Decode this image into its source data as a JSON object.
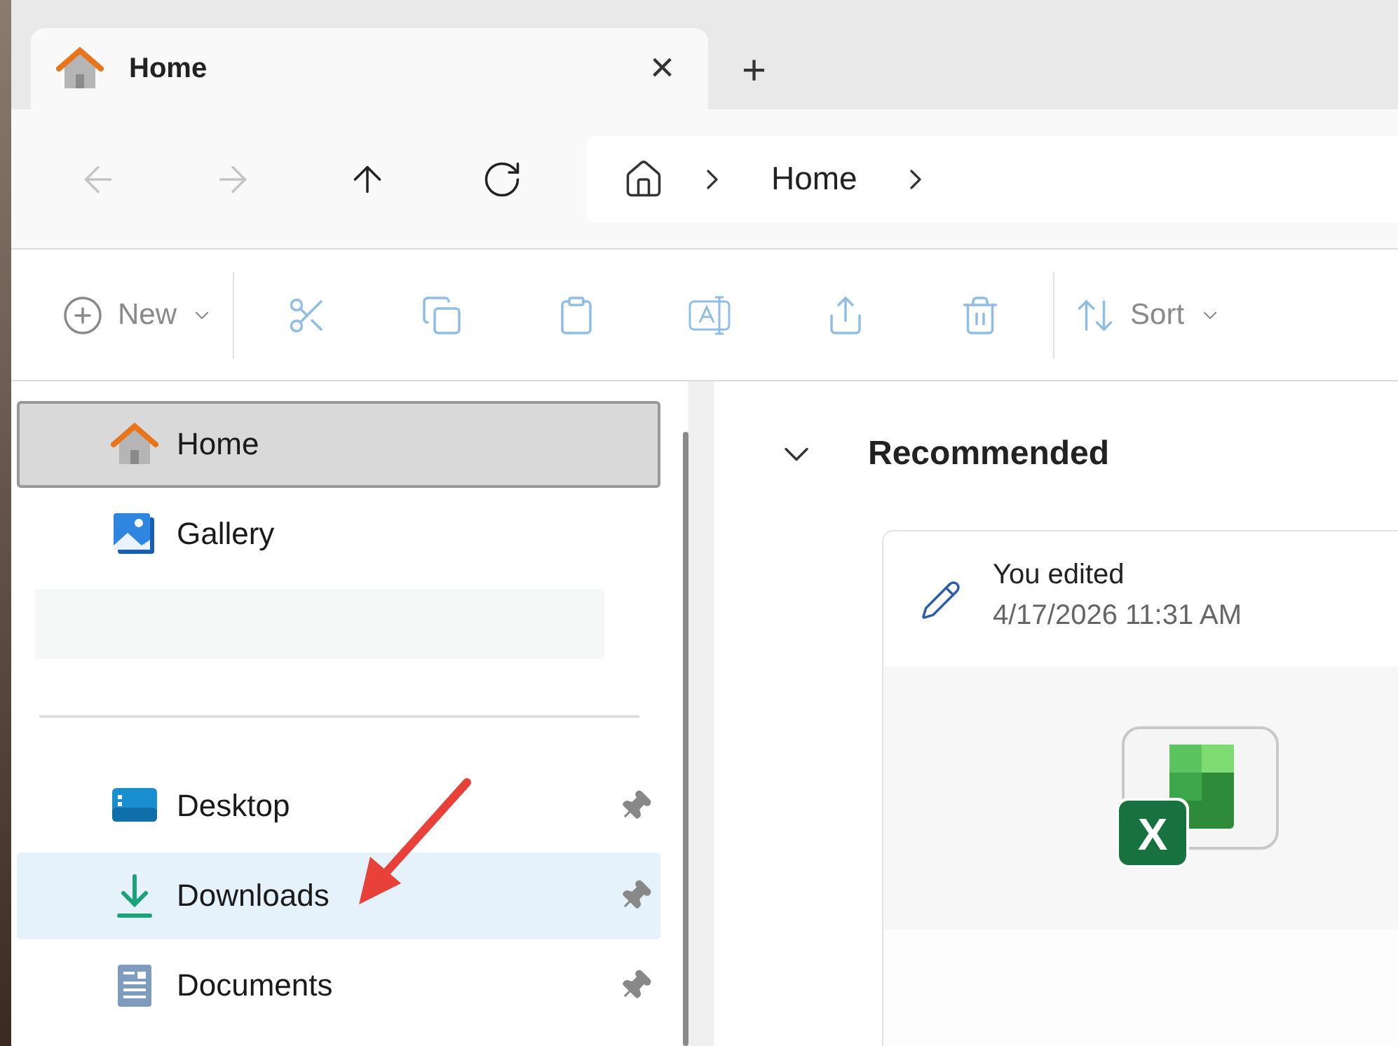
{
  "tabs": [
    {
      "label": "Home",
      "selected": true,
      "close": "×",
      "new_tab": "+"
    }
  ],
  "navigation": [
    {
      "kind": "back",
      "disabled": true
    },
    {
      "kind": "forward",
      "disabled": true
    },
    {
      "kind": "up",
      "disabled": false
    },
    {
      "kind": "refresh",
      "disabled": false
    }
  ],
  "address": {
    "crumbs": [
      "Home"
    ]
  },
  "toolbar": [
    {
      "kind": "new",
      "label": "New",
      "disabled": true
    },
    {
      "kind": "separator"
    },
    {
      "kind": "cut",
      "disabled": true
    },
    {
      "kind": "copy",
      "disabled": true
    },
    {
      "kind": "paste",
      "disabled": true
    },
    {
      "kind": "rename",
      "disabled": true
    },
    {
      "kind": "share",
      "disabled": true
    },
    {
      "kind": "delete",
      "disabled": true
    },
    {
      "kind": "separator"
    },
    {
      "kind": "sort",
      "label": "Sort",
      "disabled": true
    }
  ],
  "sidebar": {
    "groups": [
      {
        "items": [
          {
            "kind": "home",
            "label": "Home",
            "selected": true,
            "highlighted": false,
            "pinned": false
          },
          {
            "kind": "gallery",
            "label": "Gallery",
            "selected": false,
            "highlighted": false,
            "pinned": false
          }
        ]
      },
      {
        "items": [
          {
            "kind": "desktop",
            "label": "Desktop",
            "selected": false,
            "highlighted": false,
            "pinned": true
          },
          {
            "kind": "downloads",
            "label": "Downloads",
            "selected": false,
            "highlighted": true,
            "pinned": true
          },
          {
            "kind": "documents",
            "label": "Documents",
            "selected": false,
            "highlighted": false,
            "pinned": true
          }
        ]
      }
    ]
  },
  "recommended": {
    "title": "Recommended",
    "expanded": true,
    "cards": [
      {
        "activity": "You edited",
        "time": "4/17/2026 11:31 AM",
        "file_letter": "X"
      }
    ]
  }
}
